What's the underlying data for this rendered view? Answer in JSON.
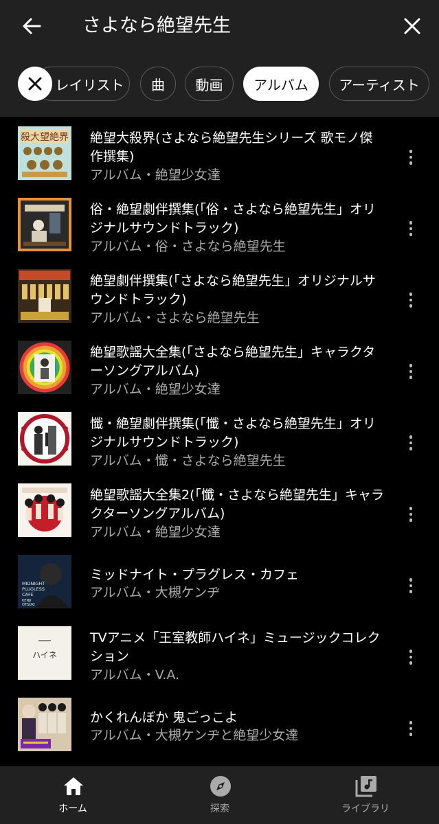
{
  "header": {
    "query": "さよなら絶望先生",
    "back_icon": "arrow-left-icon",
    "close_icon": "close-icon"
  },
  "filters": {
    "clear_icon": "close-icon",
    "chips": [
      {
        "label": "レイリスト",
        "selected": false
      },
      {
        "label": "曲",
        "selected": false
      },
      {
        "label": "動画",
        "selected": false
      },
      {
        "label": "アルバム",
        "selected": true
      },
      {
        "label": "アーティスト",
        "selected": false
      }
    ]
  },
  "results": [
    {
      "title": "絶望大殺界(さよなら絶望先生シリーズ 歌モノ傑作撰集)",
      "subtitle": "アルバム・絶望少女達"
    },
    {
      "title": "俗・絶望劇伴撰集(「俗・さよなら絶望先生」オリジナルサウンドトラック)",
      "subtitle": "アルバム・俗・さよなら絶望先生"
    },
    {
      "title": "絶望劇伴撰集(「さよなら絶望先生」オリジナルサウンドトラック)",
      "subtitle": "アルバム・さよなら絶望先生"
    },
    {
      "title": "絶望歌謡大全集(「さよなら絶望先生」キャラクターソングアルバム)",
      "subtitle": "アルバム・絶望少女達"
    },
    {
      "title": "懺・絶望劇伴撰集(「懺・さよなら絶望先生」オリジナルサウンドトラック)",
      "subtitle": "アルバム・懺・さよなら絶望先生"
    },
    {
      "title": "絶望歌謡大全集2(「懺・さよなら絶望先生」キャラクターソングアルバム)",
      "subtitle": "アルバム・絶望少女達"
    },
    {
      "title": "ミッドナイト・プラグレス・カフェ",
      "subtitle": "アルバム・大槻ケンヂ"
    },
    {
      "title": "TVアニメ「王室教師ハイネ」ミュージックコレクション",
      "subtitle": "アルバム・V.A."
    },
    {
      "title": "かくれんぼか 鬼ごっこよ",
      "subtitle": "アルバム・大槻ケンヂと絶望少女達"
    }
  ],
  "artwork_text": {
    "album1": "殺大望絶界",
    "album7": [
      "MIDNIGHT",
      "PLUGLESS",
      "CAFE",
      "KENJI",
      "OTSUKI"
    ],
    "album8": "ハイネ"
  },
  "bottom_nav": [
    {
      "label": "ホーム",
      "icon": "home-icon",
      "active": true
    },
    {
      "label": "探索",
      "icon": "compass-icon",
      "active": false
    },
    {
      "label": "ライブラリ",
      "icon": "library-icon",
      "active": false
    }
  ],
  "colors": {
    "header_bg": "#212121",
    "background": "#000000",
    "subtitle_text": "#aaaaaa"
  }
}
